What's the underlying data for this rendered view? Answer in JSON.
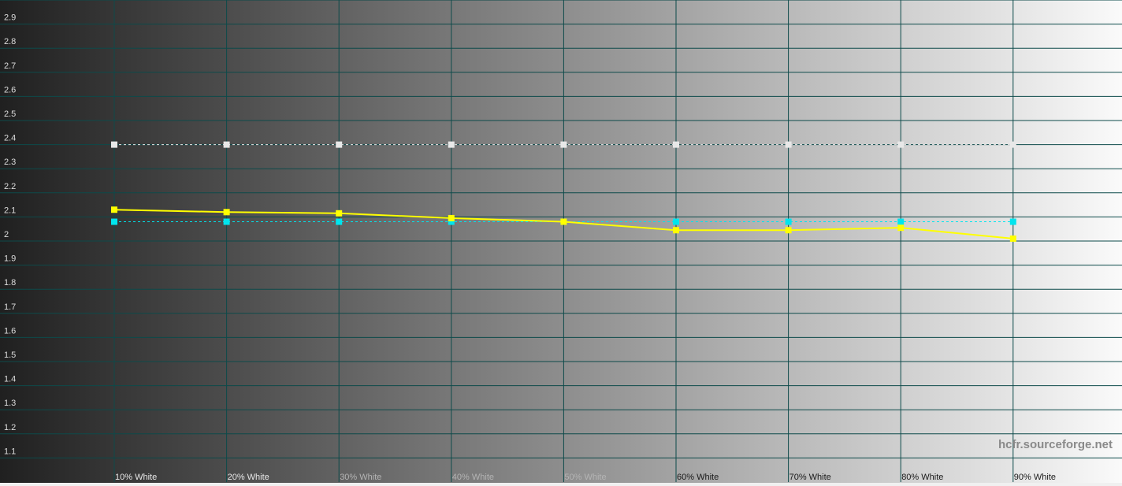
{
  "chart_data": {
    "type": "line",
    "title": "",
    "xlabel": "",
    "ylabel": "",
    "categories": [
      "10% White",
      "20% White",
      "30% White",
      "40% White",
      "50% White",
      "60% White",
      "70% White",
      "80% White",
      "90% White"
    ],
    "y_ticks": [
      "1.1",
      "1.2",
      "1.3",
      "1.4",
      "1.5",
      "1.6",
      "1.7",
      "1.8",
      "1.9",
      "2",
      "2.1",
      "2.2",
      "2.3",
      "2.4",
      "2.5",
      "2.6",
      "2.7",
      "2.8",
      "2.9"
    ],
    "ylim": [
      1.0,
      3.0
    ],
    "grid": true,
    "background": "grayscale gradient black-to-white",
    "series": [
      {
        "color": "#ffff00",
        "style": "solid",
        "values": [
          2.13,
          2.12,
          2.115,
          2.095,
          2.08,
          2.045,
          2.045,
          2.055,
          2.01
        ]
      },
      {
        "color": "#00e5ee",
        "style": "dashed",
        "values": [
          2.08,
          2.08,
          2.08,
          2.08,
          2.08,
          2.08,
          2.08,
          2.08,
          2.08
        ]
      },
      {
        "color": "#e8e8e8",
        "style": "dashed",
        "values": [
          2.4,
          2.4,
          2.4,
          2.4,
          2.4,
          2.4,
          2.4,
          2.4,
          2.4
        ]
      }
    ],
    "colors": {
      "grid": "#0d4a4a",
      "gradient_start": "#202020",
      "gradient_end": "#fafafa"
    }
  },
  "watermark": "hcfr.sourceforge.net"
}
